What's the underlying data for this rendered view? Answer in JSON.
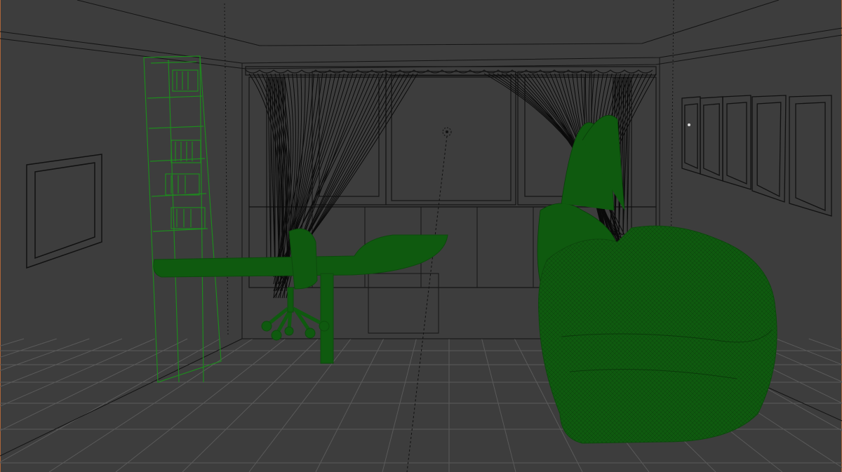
{
  "viewport": {
    "mode": "wireframe",
    "colors": {
      "background": "#3d3d3d",
      "wire": "#111111",
      "grid": "#5a5a5a",
      "selected_wire": "#1e8a1e",
      "selected_fill": "#0f5a0f",
      "axis_y": "#8a3a3a",
      "frame_edge": "#c8703a"
    }
  },
  "scene": {
    "objects": [
      {
        "name": "room-walls",
        "selected": false
      },
      {
        "name": "window-left",
        "selected": false
      },
      {
        "name": "window-center",
        "selected": false
      },
      {
        "name": "window-right",
        "selected": false
      },
      {
        "name": "curtain-left",
        "selected": false
      },
      {
        "name": "curtain-right",
        "selected": false
      },
      {
        "name": "bookshelf",
        "selected": true
      },
      {
        "name": "desk",
        "selected": true
      },
      {
        "name": "office-chair",
        "selected": true
      },
      {
        "name": "plant",
        "selected": true
      },
      {
        "name": "sofa",
        "selected": true
      },
      {
        "name": "picture-frame",
        "selected": false
      },
      {
        "name": "wall-panels",
        "selected": false
      },
      {
        "name": "lamp",
        "selected": false
      }
    ]
  }
}
